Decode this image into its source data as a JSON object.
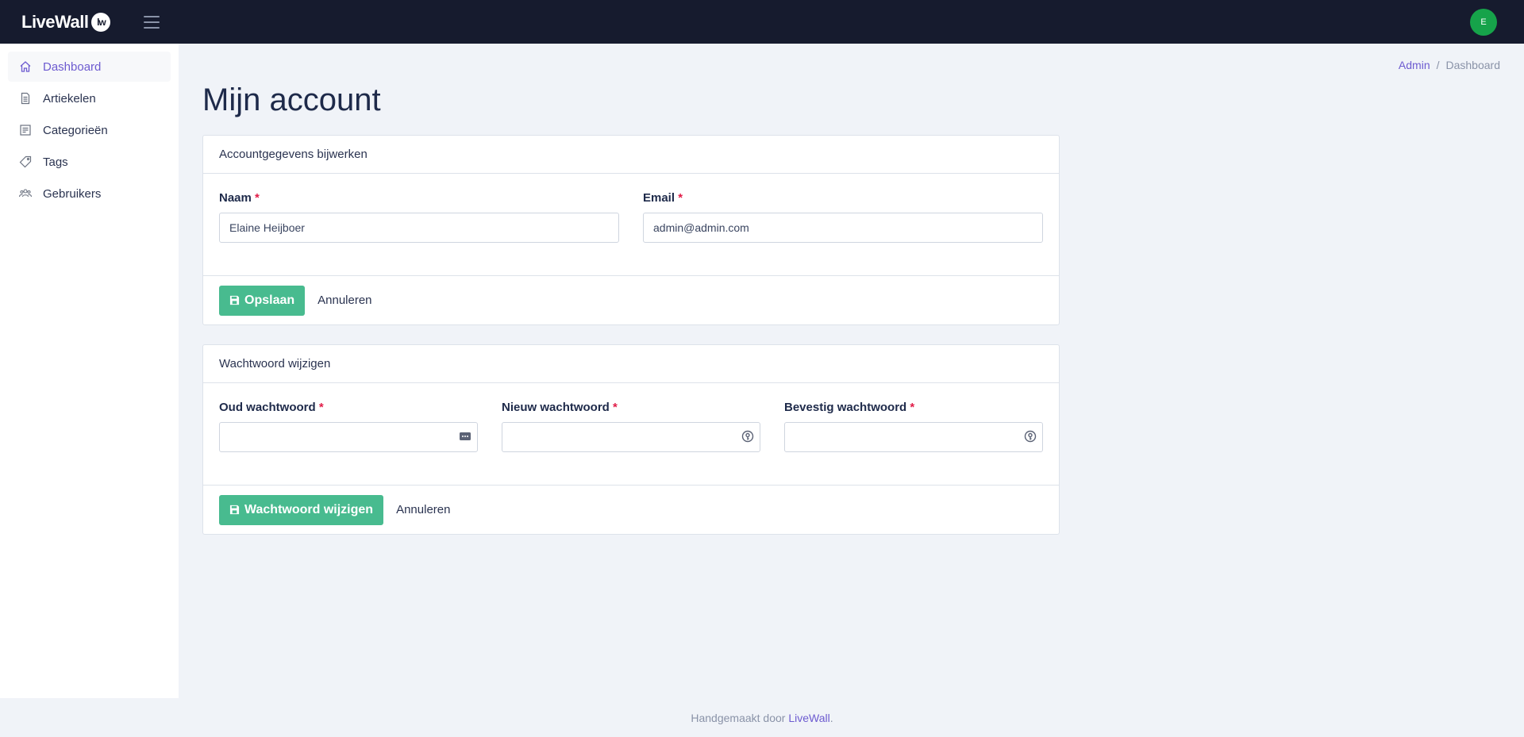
{
  "topbar": {
    "logo_text": "LiveWall",
    "logo_badge": "lw",
    "avatar_initial": "E"
  },
  "sidebar": {
    "items": [
      {
        "label": "Dashboard",
        "icon": "home-icon",
        "active": true
      },
      {
        "label": "Artiekelen",
        "icon": "document-icon"
      },
      {
        "label": "Categorieën",
        "icon": "list-icon"
      },
      {
        "label": "Tags",
        "icon": "tag-icon"
      },
      {
        "label": "Gebruikers",
        "icon": "users-icon"
      }
    ]
  },
  "breadcrumb": {
    "root": "Admin",
    "separator": "/",
    "current": "Dashboard"
  },
  "page": {
    "title": "Mijn account"
  },
  "account_card": {
    "header": "Accountgegevens bijwerken",
    "name_label": "Naam",
    "name_value": "Elaine Heijboer",
    "email_label": "Email",
    "email_value": "admin@admin.com",
    "required_mark": "*",
    "save_label": "Opslaan",
    "cancel_label": "Annuleren"
  },
  "password_card": {
    "header": "Wachtwoord wijzigen",
    "old_label": "Oud wachtwoord",
    "new_label": "Nieuw wachtwoord",
    "confirm_label": "Bevestig wachtwoord",
    "required_mark": "*",
    "save_label": "Wachtwoord wijzigen",
    "cancel_label": "Annuleren"
  },
  "footer": {
    "text": "Handgemaakt door ",
    "link": "LiveWall",
    "suffix": "."
  },
  "colors": {
    "topbar": "#161b2e",
    "accent": "#6d5bd0",
    "button_green": "#48bb8f",
    "avatar": "#16a34a",
    "required": "#e11d48"
  }
}
